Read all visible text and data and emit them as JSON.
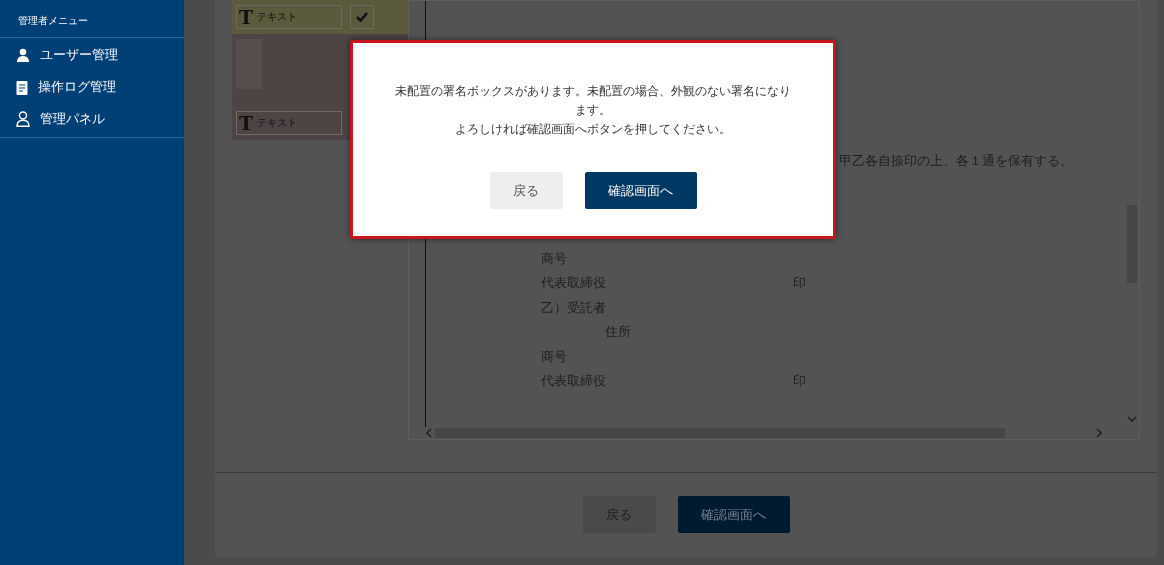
{
  "sidebar": {
    "title": "管理者メニュー",
    "items": [
      {
        "kind": "user",
        "label": "ユーザー管理"
      },
      {
        "kind": "log",
        "label": "操作ログ管理"
      },
      {
        "kind": "panel",
        "label": "管理パネル"
      }
    ]
  },
  "palette": [
    {
      "kind": "text",
      "glyph": "T",
      "label": "テキスト",
      "checked": true,
      "color": "#5c5a3c"
    },
    {
      "kind": "image-text",
      "glyph": "T",
      "label": "テキスト",
      "color": "#4d4444"
    }
  ],
  "document": {
    "lines": [
      {
        "kind": "clause",
        "text": "甲乙各自捺印の上、各１通を保有する。"
      },
      {
        "kind": "field",
        "text": "商号"
      },
      {
        "kind": "field",
        "text": "代表取締役",
        "seal": "印"
      },
      {
        "kind": "field",
        "text": "乙）受託者"
      },
      {
        "kind": "sub",
        "text": "住所"
      },
      {
        "kind": "field",
        "text": "商号"
      },
      {
        "kind": "field",
        "text": "代表取締役",
        "seal": "印"
      }
    ]
  },
  "footer": {
    "back": "戻る",
    "confirm": "確認画面へ"
  },
  "dialog": {
    "message": [
      "未配置の署名ボックスがあります。未配置の場合、外観のない署名になります。",
      "よろしければ確認画面へボタンを押してください。"
    ],
    "back": "戻る",
    "confirm": "確認画面へ"
  }
}
